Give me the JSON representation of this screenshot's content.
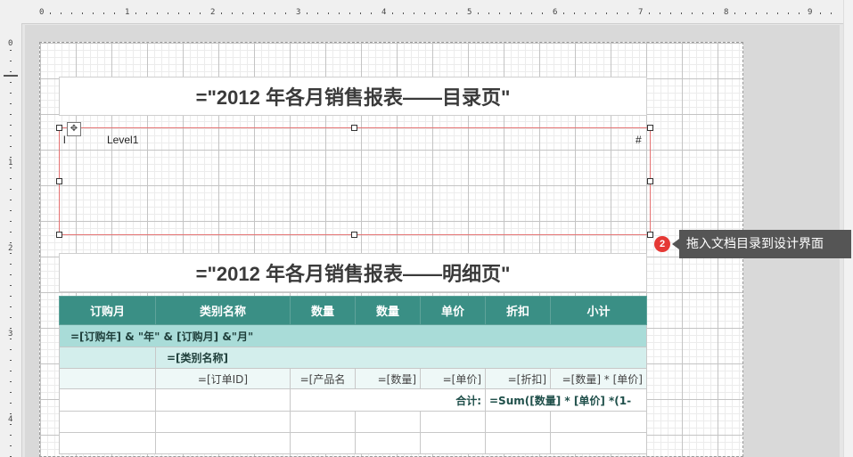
{
  "ruler": {
    "horizontal": [
      "0",
      "1",
      "2",
      "3",
      "4",
      "5",
      "6",
      "7",
      "8",
      "9"
    ],
    "vertical": [
      "0",
      "1",
      "2",
      "3",
      "4"
    ]
  },
  "report": {
    "toc_title": "=\"2012 年各月销售报表——目录页\"",
    "toc": {
      "left": "l",
      "level": "Level1",
      "page": "#"
    },
    "detail_title": "=\"2012 年各月销售报表——明细页\"",
    "headers": [
      "订购月",
      "类别名称",
      "数量",
      "数量",
      "单价",
      "折扣",
      "小计"
    ],
    "group1": "=[订购年] & \"年\"  & [订购月]  &\"月\"",
    "group2": "=[类别名称]",
    "detail": [
      "",
      "=[订单ID]",
      "=[产品名",
      "=[数量]",
      "=[单价]",
      "=[折扣]",
      "=[数量] * [单价]"
    ],
    "sum_label": "合计:",
    "sum_formula": "=Sum([数量] * [单价] *(1-"
  },
  "callout": {
    "number": "2",
    "text": "拖入文档目录到设计界面"
  },
  "colors": {
    "header": "#3a8f85",
    "group1": "#a9dcd8",
    "group2": "#d3eeec",
    "callout_badge": "#e53935"
  }
}
